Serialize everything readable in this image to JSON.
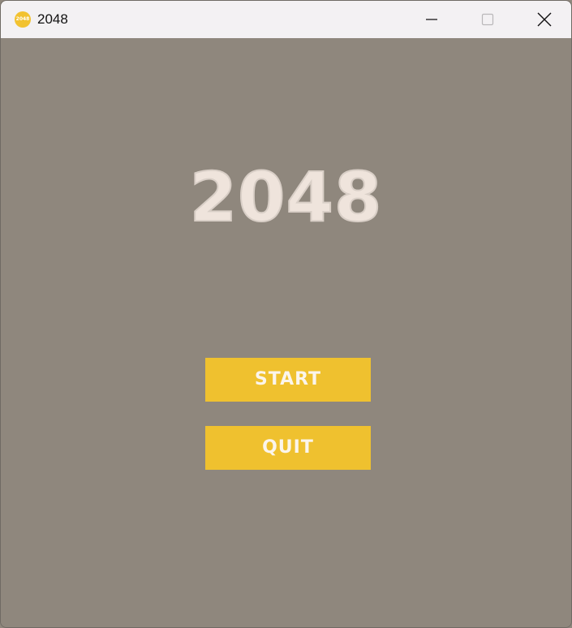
{
  "window": {
    "title": "2048",
    "icon": "2048-coin-icon",
    "icon_label": "2048",
    "controls": [
      "minimize-icon",
      "maximize-icon",
      "close-icon"
    ]
  },
  "game": {
    "title": "2048",
    "buttons": {
      "start_label": "START",
      "quit_label": "QUIT"
    }
  },
  "colors": {
    "background": "#8f877d",
    "title_text": "#efe4dc",
    "button_bg": "#efc12f",
    "button_text": "#fbf5ec",
    "titlebar": "#f3f1f3"
  }
}
